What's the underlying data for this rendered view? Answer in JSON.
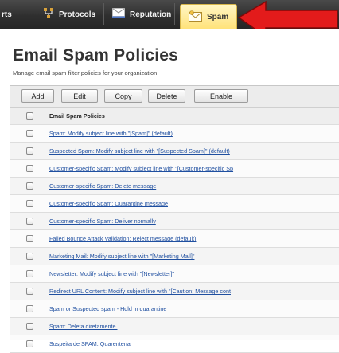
{
  "nav": {
    "items": [
      {
        "label": "rts"
      },
      {
        "label": "Protocols",
        "icon": "network-icon"
      },
      {
        "label": "Reputation",
        "icon": "reputation-icon"
      },
      {
        "label": "Spam",
        "icon": "envelope-icon"
      }
    ],
    "active": "Spam"
  },
  "annotation": {
    "arrow_color": "#e31b1b"
  },
  "page": {
    "title": "Email Spam Policies",
    "subtitle": "Manage email spam filter policies for your organization."
  },
  "toolbar": {
    "buttons": [
      "Add",
      "Edit",
      "Copy",
      "Delete",
      "Enable"
    ]
  },
  "table": {
    "header": "Email Spam Policies",
    "rows": [
      "Spam: Modify subject line with \"[Spam]\" (default)",
      "Suspected Spam: Modify subject line with \"[Suspected Spam]\" (default)",
      "Customer-specific Spam: Modify subject line with \"[Customer-specific Sp",
      "Customer-specific Spam: Delete message",
      "Customer-specific Spam: Quarantine message",
      "Customer-specific Spam: Deliver normally",
      "Failed Bounce Attack Validation: Reject message (default)",
      "Marketing Mail: Modify subject line with \"[Marketing Mail]\"",
      "Newsletter: Modify subject line with \"[Newsletter]\"",
      "Redirect URL Content: Modify subject line with \"[Caution: Message cont",
      "Spam or Suspected spam - Hold in quarantine",
      "Spam: Deleta diretamente.",
      "Suspeita de SPAM: Quarentena"
    ]
  }
}
